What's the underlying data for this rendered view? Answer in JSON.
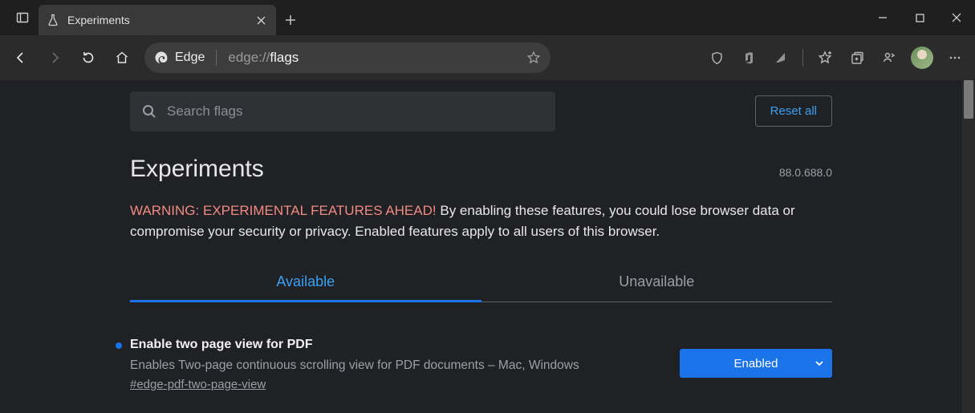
{
  "tab": {
    "title": "Experiments"
  },
  "address": {
    "edge_label": "Edge",
    "url_prefix": "edge://",
    "url_path": "flags"
  },
  "search": {
    "placeholder": "Search flags",
    "reset_label": "Reset all"
  },
  "page": {
    "heading": "Experiments",
    "version": "88.0.688.0",
    "warning_label": "WARNING: EXPERIMENTAL FEATURES AHEAD!",
    "warning_body": "By enabling these features, you could lose browser data or compromise your security or privacy. Enabled features apply to all users of this browser."
  },
  "tabs": {
    "available": "Available",
    "unavailable": "Unavailable"
  },
  "flag": {
    "title": "Enable two page view for PDF",
    "description": "Enables Two-page continuous scrolling view for PDF documents – Mac, Windows",
    "anchor": "#edge-pdf-two-page-view",
    "selected": "Enabled"
  }
}
